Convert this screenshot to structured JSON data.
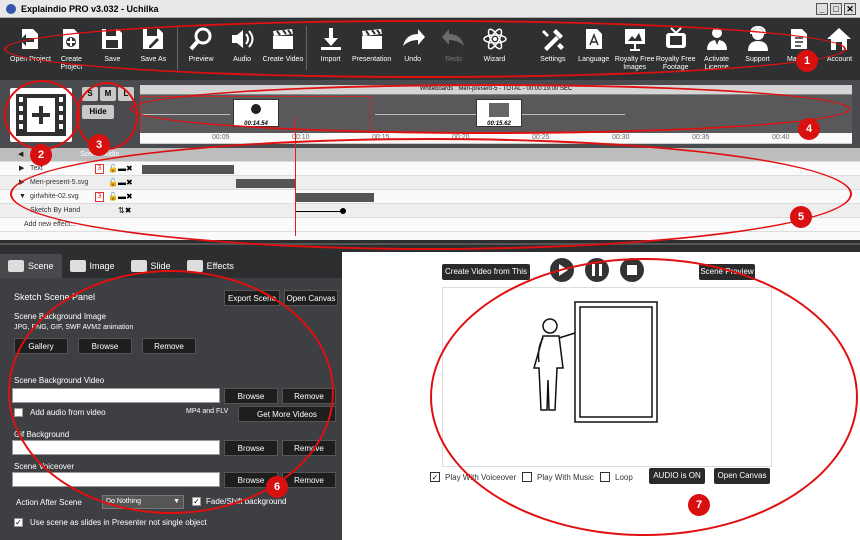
{
  "window": {
    "title": "Explaindio PRO v3.032 - Uchilka",
    "minimize": "_",
    "maximize": "□",
    "close": "✕"
  },
  "toolbar": [
    {
      "label": "Open Project",
      "icon": "open-project-icon"
    },
    {
      "label": "Create Project",
      "icon": "create-project-icon"
    },
    {
      "label": "Save",
      "icon": "save-icon"
    },
    {
      "label": "Save As",
      "icon": "save-as-icon"
    },
    {
      "label": "Preview",
      "icon": "preview-icon"
    },
    {
      "label": "Audio",
      "icon": "audio-icon"
    },
    {
      "label": "Create Video",
      "icon": "create-video-icon"
    },
    {
      "label": "Import",
      "icon": "import-icon"
    },
    {
      "label": "Presentation",
      "icon": "presentation-icon"
    },
    {
      "label": "Undo",
      "icon": "undo-icon"
    },
    {
      "label": "Redo",
      "icon": "redo-icon"
    },
    {
      "label": "Wizard",
      "icon": "wizard-icon"
    },
    {
      "label": "Settings",
      "icon": "settings-icon"
    },
    {
      "label": "Language",
      "icon": "language-icon"
    },
    {
      "label": "Royalty Free Images",
      "icon": "royalty-images-icon"
    },
    {
      "label": "Royalty Free Footage",
      "icon": "royalty-footage-icon"
    },
    {
      "label": "Activate License",
      "icon": "activate-license-icon"
    },
    {
      "label": "Support",
      "icon": "support-icon"
    },
    {
      "label": "Manual",
      "icon": "manual-icon"
    },
    {
      "label": "Account",
      "icon": "account-icon"
    }
  ],
  "timeline": {
    "size_buttons": [
      "S",
      "M",
      "L"
    ],
    "hide_label": "Hide",
    "info": "Whiteboards : Men-present-5 - TOTAL - 00:00:19.00 SEC",
    "thumbs": [
      {
        "time": "00:14.54"
      },
      {
        "time": "00:15.62"
      }
    ],
    "ruler": [
      "00:05",
      "00:10",
      "00:15",
      "00:20",
      "00:25",
      "00:30",
      "00:35",
      "00:40"
    ],
    "audio_row": "Scene Audio",
    "tracks": [
      {
        "name": "Text",
        "num": "3"
      },
      {
        "name": "Men-present-5.svg",
        "num": ""
      },
      {
        "name": "girlwhite-02.svg",
        "num": "3"
      },
      {
        "name": "Sketch By Hand",
        "num": ""
      },
      {
        "name": "Add new effect...",
        "num": ""
      }
    ]
  },
  "panel": {
    "tabs": [
      "Scene",
      "Image",
      "Slide",
      "Effects"
    ],
    "title": "Sketch Scene Panel",
    "export_scene": "Export Scene",
    "open_canvas": "Open Canvas",
    "bg_image_label": "Scene Background Image",
    "bg_image_hint": "JPG, PNG, GIF, SWF AVM2 animation",
    "gallery": "Gallery",
    "browse": "Browse",
    "remove": "Remove",
    "bg_video_label": "Scene Background Video",
    "add_audio_video": "Add audio from video",
    "mp4_flv": "MP4 and FLV",
    "get_more_videos": "Get More Videos",
    "gif_bg_label": "Gif Background",
    "voiceover_label": "Scene Voiceover",
    "action_after_label": "Action After Scene",
    "action_after_value": "Do Nothing",
    "fade_shift": "Fade/Shift background",
    "use_as_slides": "Use scene as slides in Presenter not single object"
  },
  "preview": {
    "create_video": "Create Video from This Scene",
    "scene_preview": "Scene Preview",
    "play_voiceover": "Play With Voiceover",
    "play_music": "Play With Music",
    "loop": "Loop",
    "audio_on": "AUDIO is ON",
    "open_canvas": "Open Canvas"
  },
  "annotations": [
    "1",
    "2",
    "3",
    "4",
    "5",
    "6",
    "7"
  ],
  "colors": {
    "toolbar_bg": "#2f3032",
    "annotation": "#e01010",
    "timeline_bg": "#4a4b4e"
  }
}
